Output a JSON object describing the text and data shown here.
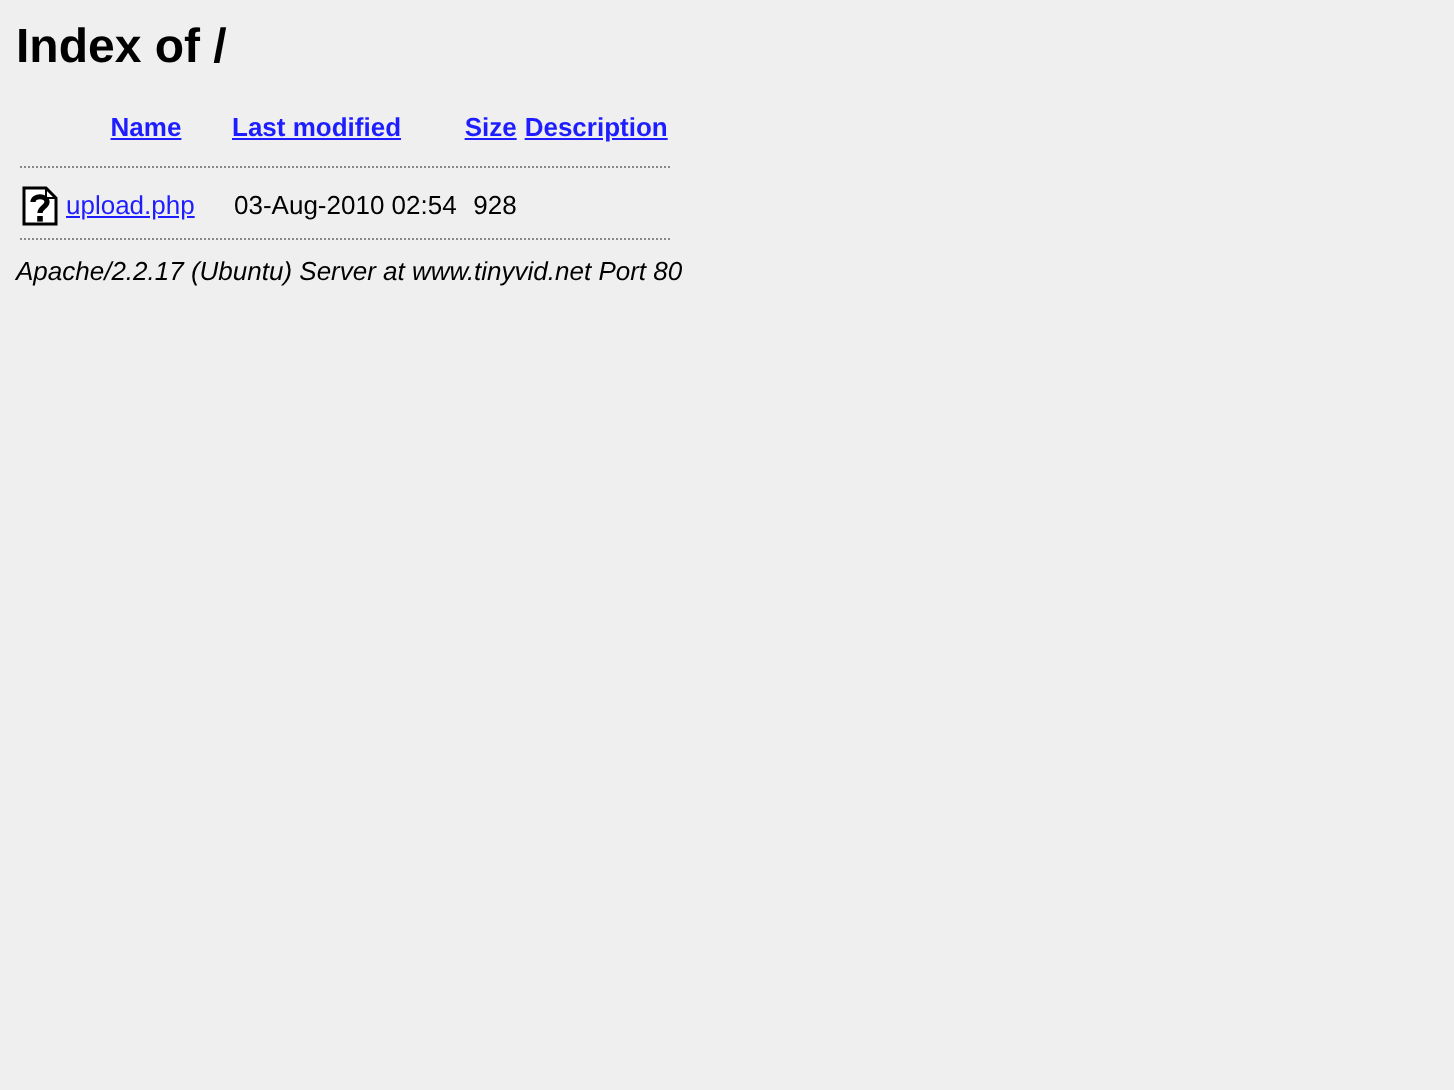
{
  "title": "Index of /",
  "columns": [
    "Name",
    "Last modified",
    "Size",
    "Description"
  ],
  "rows": [
    {
      "kind": "unknown",
      "name": "upload.php",
      "last_modified": "03-Aug-2010 02:54",
      "size": "928"
    }
  ],
  "address": "Apache/2.2.17 (Ubuntu) Server at www.tinyvid.net Port 80"
}
